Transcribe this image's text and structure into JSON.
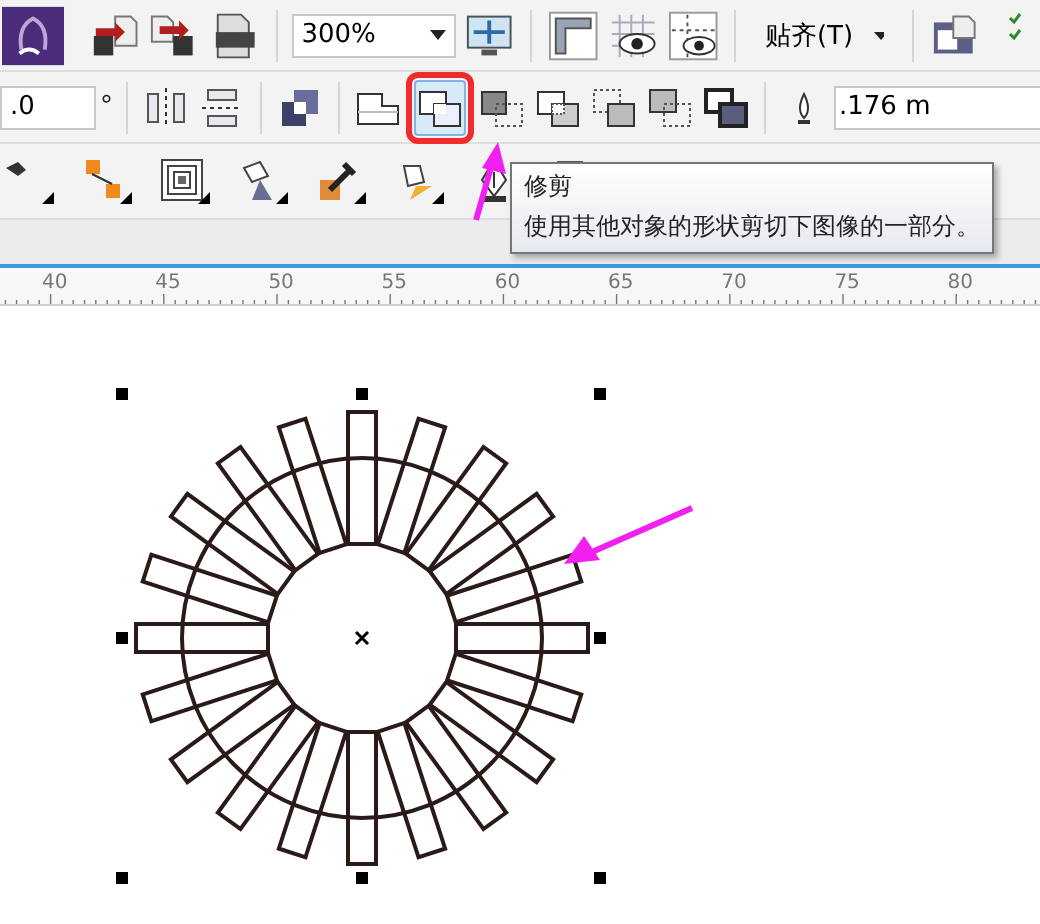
{
  "toolbar_standard": {
    "zoom": "300%",
    "snap_menu": "贴齐(T)"
  },
  "toolbar_property": {
    "angle": ".0",
    "degree_sign": "°",
    "outline_width": ".176 m",
    "shaping_buttons": [
      {
        "selected": false
      },
      {
        "selected": true
      },
      {
        "selected": false
      },
      {
        "selected": false
      },
      {
        "selected": false
      },
      {
        "selected": false
      },
      {
        "selected": false
      }
    ]
  },
  "tooltip": {
    "title": "修剪",
    "text": "使用其他对象的形状剪切下图像的一部分。"
  },
  "ruler": {
    "labels": [
      "40",
      "45",
      "50",
      "55",
      "60",
      "65",
      "70",
      "75",
      "80"
    ]
  }
}
